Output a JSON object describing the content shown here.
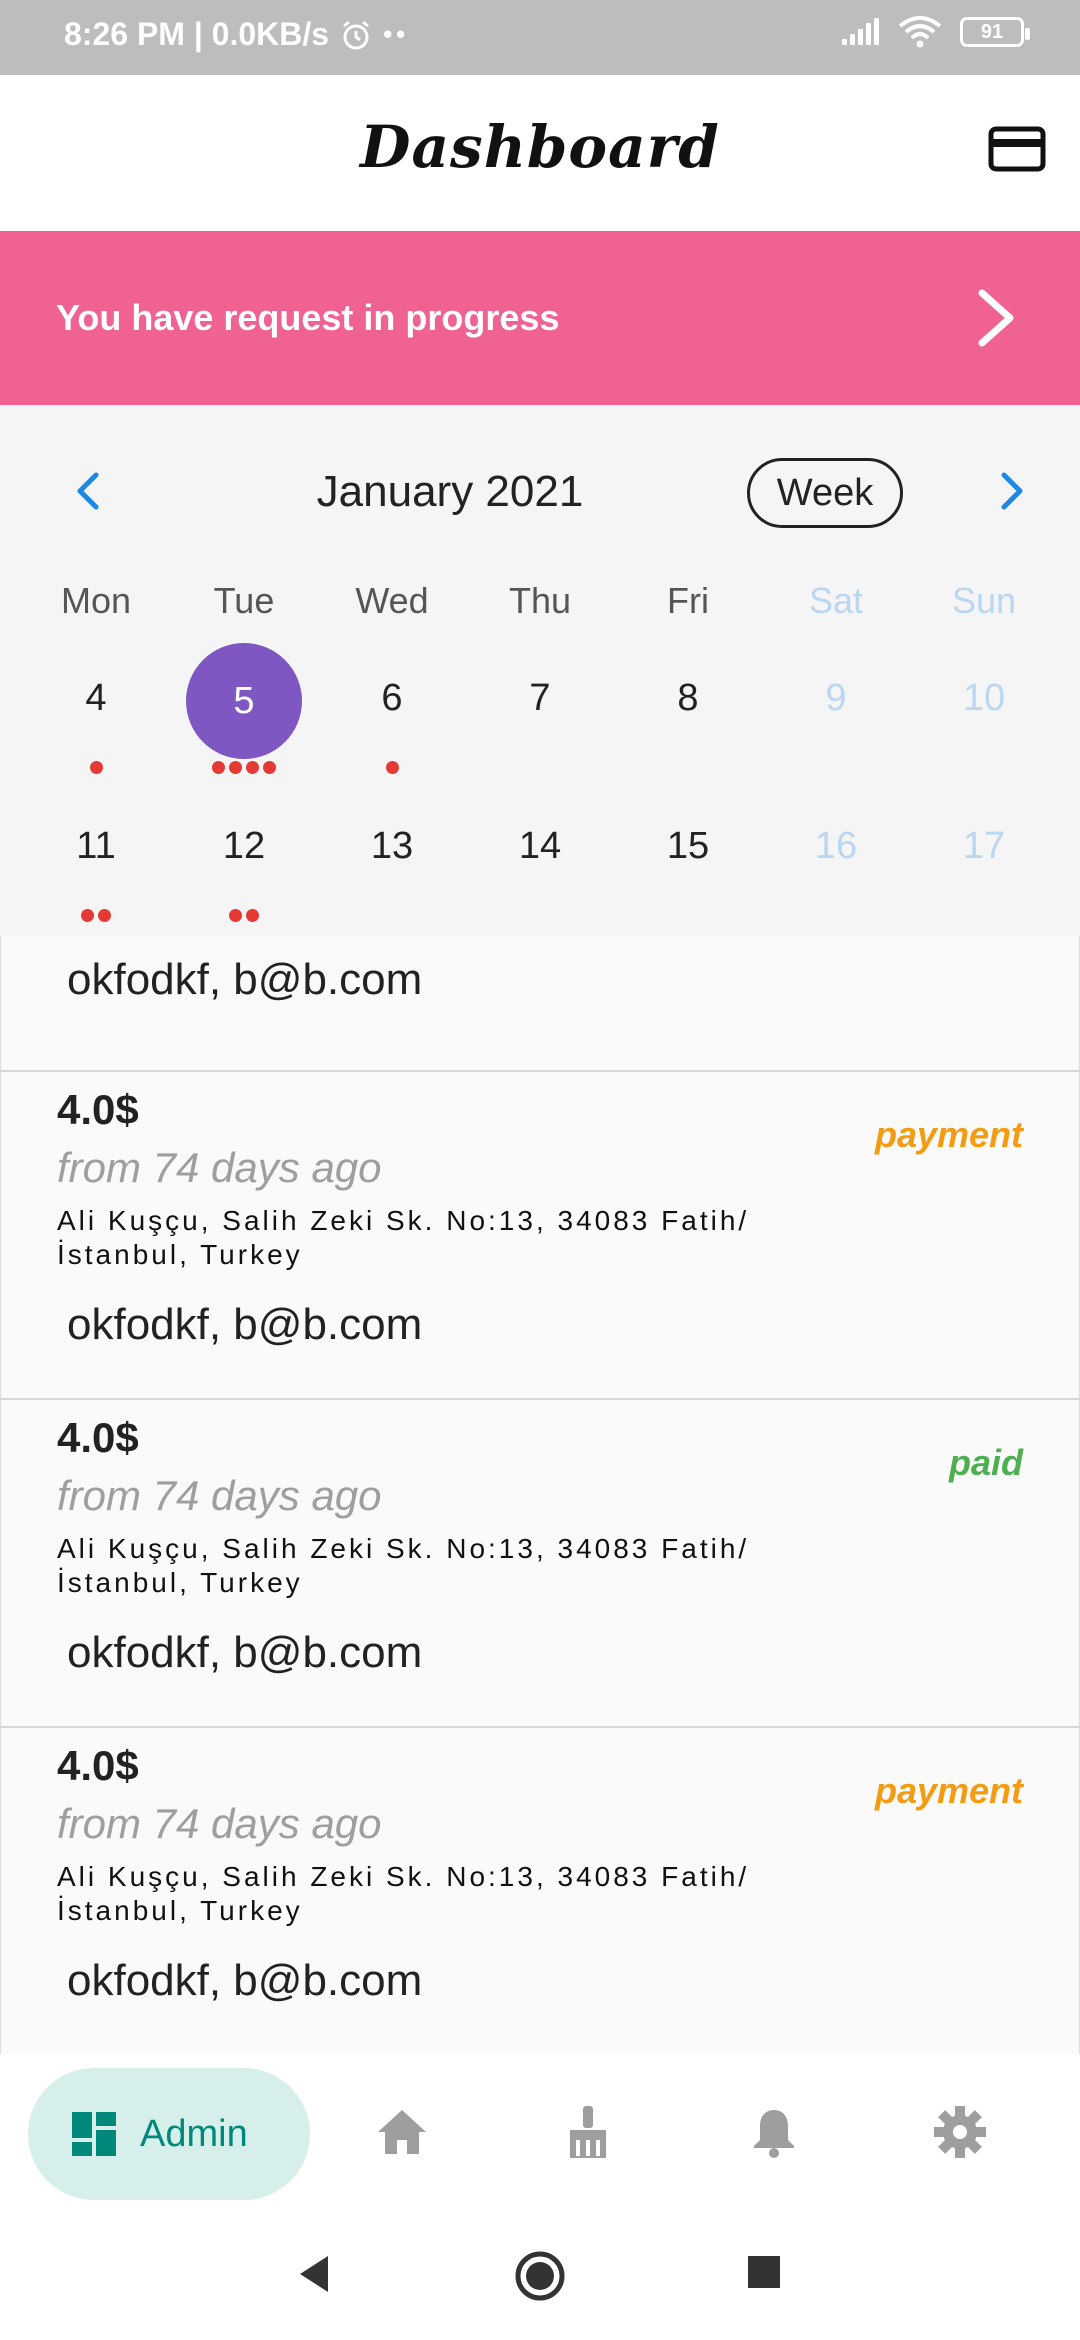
{
  "status_bar": {
    "time": "8:26 PM | 0.0KB/s",
    "battery": "91"
  },
  "app_bar": {
    "title": "Dashboard",
    "card_icon": "credit-card-icon"
  },
  "banner": {
    "text": "You have request in progress"
  },
  "calendar": {
    "month": "January 2021",
    "format_button": "Week",
    "weekdays": [
      "Mon",
      "Tue",
      "Wed",
      "Thu",
      "Fri",
      "Sat",
      "Sun"
    ],
    "week1": [
      "4",
      "5",
      "6",
      "7",
      "8",
      "9",
      "10"
    ],
    "week1_events": [
      1,
      4,
      1,
      0,
      0,
      0,
      0
    ],
    "week2": [
      "11",
      "12",
      "13",
      "14",
      "15",
      "16",
      "17"
    ],
    "week2_events": [
      2,
      2,
      0,
      0,
      0,
      0,
      0
    ],
    "selected_day": "5",
    "colors": {
      "selected": "#7e57c2",
      "event_dot": "#e53935",
      "weekend": "#b9d6f2"
    }
  },
  "partial_item": {
    "customer": "okfodkf, b@b.com"
  },
  "requests": [
    {
      "amount": "4.0$",
      "ago": "from 74 days ago",
      "address": "Ali Kuşçu, Salih Zeki Sk. No:13, 34083 Fatih/İstanbul, Turkey",
      "status": "payment",
      "status_color": "#f39c12",
      "customer": "okfodkf, b@b.com"
    },
    {
      "amount": "4.0$",
      "ago": "from 74 days ago",
      "address": "Ali Kuşçu, Salih Zeki Sk. No:13, 34083 Fatih/İstanbul, Turkey",
      "status": "paid",
      "status_color": "#4caf50",
      "customer": "okfodkf, b@b.com"
    },
    {
      "amount": "4.0$",
      "ago": "from 74 days ago",
      "address": "Ali Kuşçu, Salih Zeki Sk. No:13, 34083 Fatih/İstanbul, Turkey",
      "status": "payment",
      "status_color": "#f39c12",
      "customer": "okfodkf, b@b.com"
    }
  ],
  "bottom_nav": {
    "active_label": "Admin",
    "items": [
      "dashboard-icon",
      "home-icon",
      "broom-icon",
      "bell-icon",
      "gear-icon"
    ]
  }
}
